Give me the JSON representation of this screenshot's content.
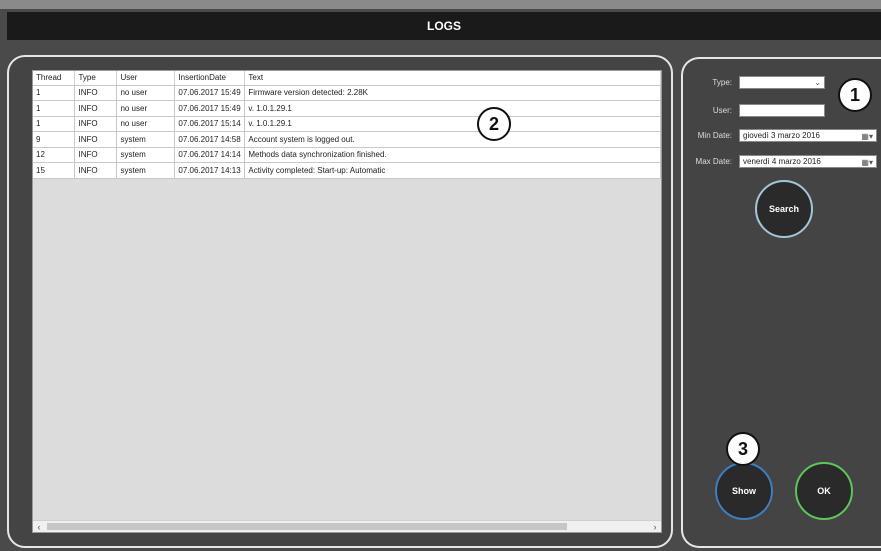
{
  "window": {
    "title": "LOGS"
  },
  "table": {
    "columns": [
      "Thread",
      "Type",
      "User",
      "InsertionDate",
      "Text"
    ],
    "rows": [
      [
        "1",
        "INFO",
        "no user",
        "07.06.2017 15:49",
        "Firmware version detected: 2.28K"
      ],
      [
        "1",
        "INFO",
        "no user",
        "07.06.2017 15:49",
        "v. 1.0.1.29.1"
      ],
      [
        "1",
        "INFO",
        "no user",
        "07.06.2017 15:14",
        "v. 1.0.1.29.1"
      ],
      [
        "9",
        "INFO",
        "system",
        "07.06.2017 14:58",
        "Account system is logged out."
      ],
      [
        "12",
        "INFO",
        "system",
        "07.06.2017 14:14",
        "Methods data synchronization finished."
      ],
      [
        "15",
        "INFO",
        "system",
        "07.06.2017 14:13",
        "Activity completed: Start-up: Automatic"
      ]
    ]
  },
  "filters": {
    "type_label": "Type:",
    "type_value": "",
    "user_label": "User:",
    "user_value": "",
    "min_date_label": "Min Date:",
    "min_date_value": "giovedì   3   marzo   2016",
    "max_date_label": "Max Date:",
    "max_date_value": "venerdì   4   marzo   2016"
  },
  "buttons": {
    "search": "Search",
    "show": "Show",
    "ok": "OK"
  },
  "callouts": {
    "filters": "1",
    "grid": "2",
    "show": "3"
  },
  "icons": {
    "dropdown": "chevron-down-icon",
    "calendar": "calendar-icon",
    "scroll_left": "scroll-left-icon",
    "scroll_right": "scroll-right-icon"
  }
}
